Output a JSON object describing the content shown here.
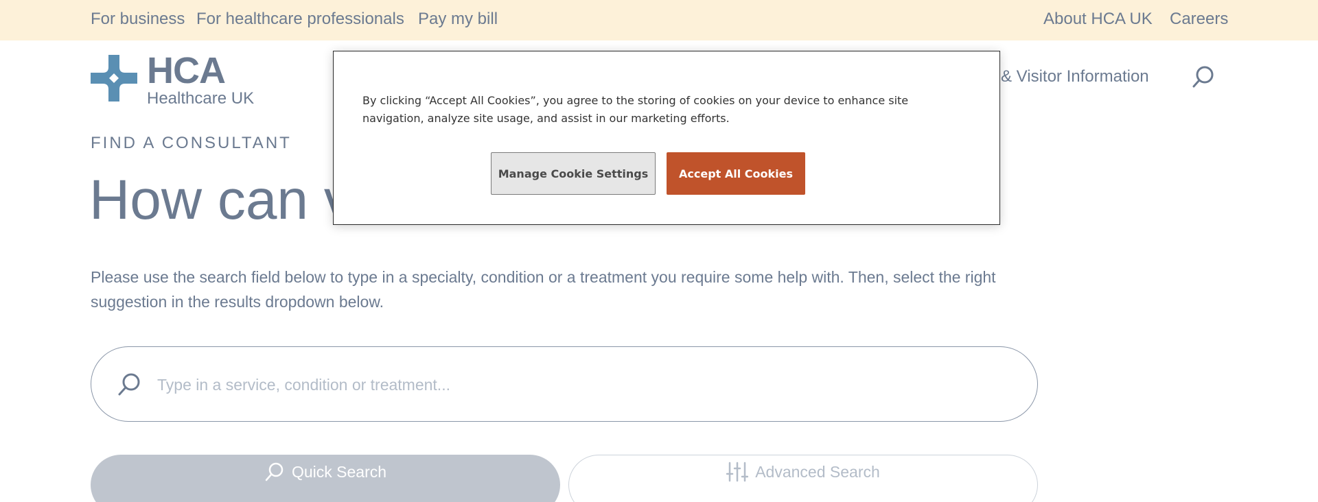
{
  "utility_bar": {
    "left_links": [
      "For business",
      "For healthcare professionals",
      "Pay my bill"
    ],
    "right_links": [
      "About HCA UK",
      "Careers"
    ]
  },
  "header": {
    "logo_main": "HCA",
    "logo_sub": "Healthcare UK",
    "nav_partial": "& Visitor Information",
    "search_icon": "search-icon"
  },
  "main": {
    "eyebrow": "FIND A CONSULTANT",
    "headline_visible": "How can v",
    "intro": "Please use the search field below to type in a specialty, condition or a treatment you require some help with.  Then, select the right suggestion in the results dropdown below.",
    "search_placeholder": "Type in a service, condition or treatment...",
    "quick_search_label": "Quick Search",
    "advanced_search_label": "Advanced Search"
  },
  "cookie_banner": {
    "text": "By clicking “Accept All Cookies”, you agree to the storing of cookies on your device to enhance site navigation, analyze site usage, and assist in our marketing efforts.",
    "manage_label": "Manage Cookie Settings",
    "accept_label": "Accept All Cookies"
  },
  "colors": {
    "utility_bg": "#fdf1d9",
    "text": "#6b7a90",
    "logo_icon": "#5a8fb3",
    "accept_button": "#c0532b",
    "quick_search_bg": "#bfc5ce"
  }
}
